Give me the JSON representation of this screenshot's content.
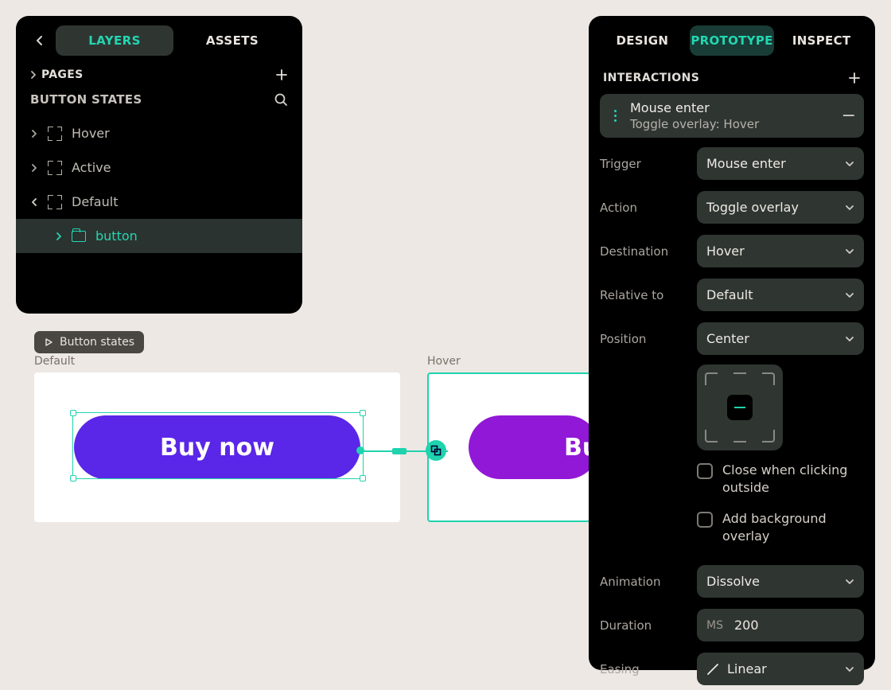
{
  "left": {
    "tabs": {
      "layers": "LAYERS",
      "assets": "ASSETS"
    },
    "pages_label": "PAGES",
    "section_title": "BUTTON STATES",
    "tree": {
      "hover": "Hover",
      "active": "Active",
      "default": "Default",
      "default_child": "button"
    }
  },
  "canvas": {
    "flow_chip": "Button states",
    "frames": {
      "default_label": "Default",
      "hover_label": "Hover",
      "button_text_default": "Buy now",
      "button_text_hover": "Bu"
    }
  },
  "right": {
    "tabs": {
      "design": "DESIGN",
      "prototype": "PROTOTYPE",
      "inspect": "INSPECT"
    },
    "interactions_label": "INTERACTIONS",
    "interaction_card": {
      "title": "Mouse enter",
      "subtitle": "Toggle overlay: Hover"
    },
    "props": {
      "trigger": {
        "label": "Trigger",
        "value": "Mouse enter"
      },
      "action": {
        "label": "Action",
        "value": "Toggle overlay"
      },
      "destination": {
        "label": "Destination",
        "value": "Hover"
      },
      "relative_to": {
        "label": "Relative to",
        "value": "Default"
      },
      "position": {
        "label": "Position",
        "value": "Center"
      },
      "animation": {
        "label": "Animation",
        "value": "Dissolve"
      },
      "duration": {
        "label": "Duration",
        "prefix": "MS",
        "value": "200"
      },
      "easing": {
        "label": "Easing",
        "value": "Linear"
      }
    },
    "options": {
      "close_outside": "Close when clicking outside",
      "bg_overlay": "Add background overlay"
    }
  }
}
